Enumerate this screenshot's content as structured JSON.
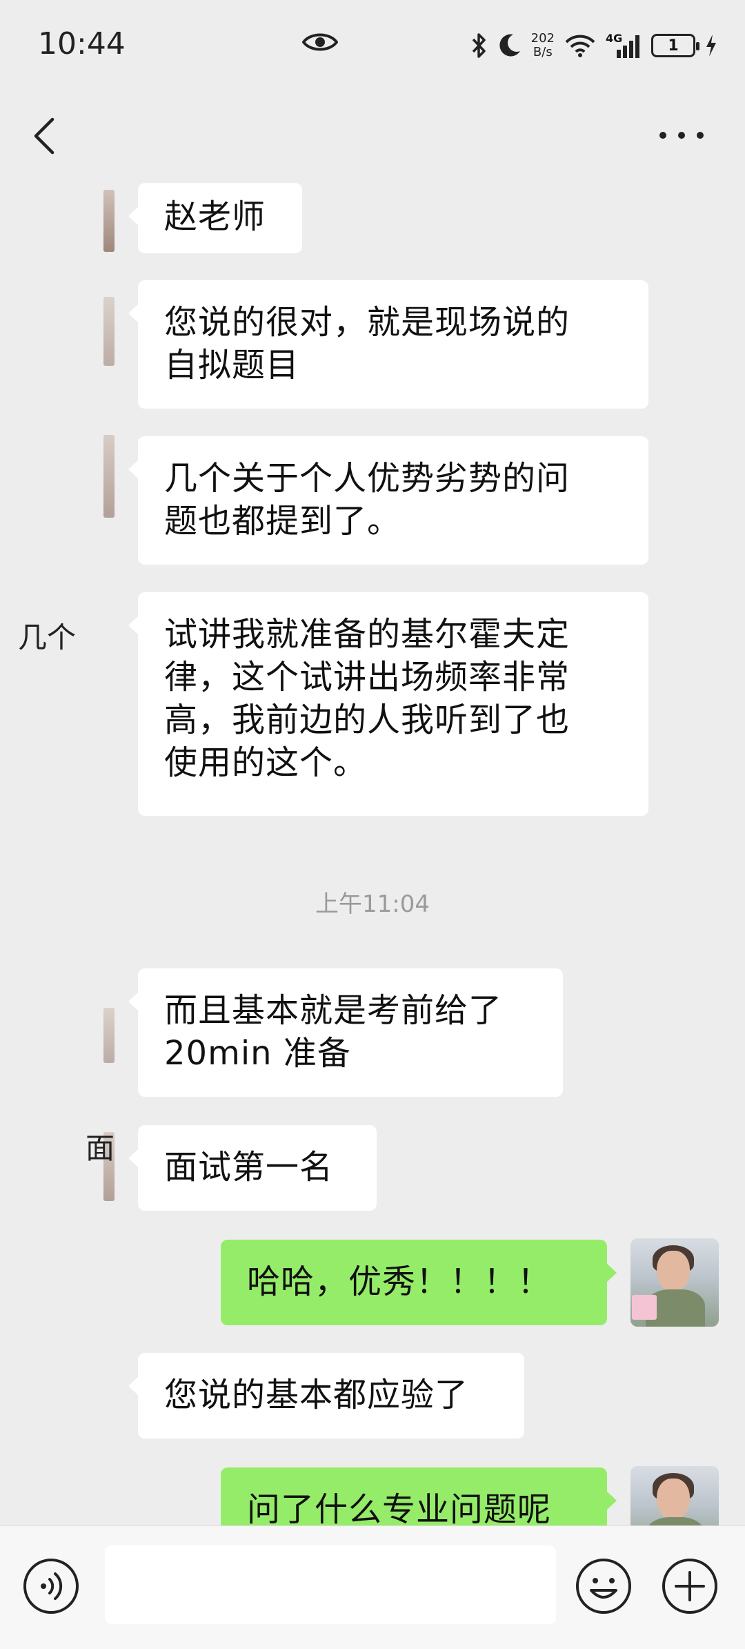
{
  "status_bar": {
    "time": "10:44",
    "net_speed_value": "202",
    "net_speed_unit": "B/s",
    "network": "4G",
    "battery": "1"
  },
  "messages": [
    {
      "side": "left",
      "text": "赵老师"
    },
    {
      "side": "left",
      "text": "您说的很对，就是现场说的\n自拟题目"
    },
    {
      "side": "left",
      "text": "几个关于个人优势劣势的问\n题也都提到了。"
    },
    {
      "side": "left",
      "text": "试讲我就准备的基尔霍夫定\n律，这个试讲出场频率非常\n高，我前边的人我听到了也\n使用的这个。"
    },
    {
      "side": "left",
      "text": "而且基本就是考前给了\n20min 准备"
    },
    {
      "side": "left",
      "text": "面试第一名"
    },
    {
      "side": "right",
      "text": "哈哈，优秀！！！！"
    },
    {
      "side": "left",
      "text": "您说的基本都应验了"
    },
    {
      "side": "right",
      "text": "问了什么专业问题呢"
    }
  ],
  "timestamp": "上午11:04",
  "fragments": {
    "frag1": "几个",
    "frag2": "面"
  },
  "input": {
    "value": ""
  },
  "colors": {
    "background": "#ededed",
    "left_bubble": "#ffffff",
    "right_bubble": "#95ec69"
  },
  "icons": [
    "eye-icon",
    "bluetooth-icon",
    "moon-icon",
    "wifi-icon",
    "signal-icon",
    "battery-icon",
    "charging-icon",
    "back-icon",
    "more-icon",
    "voice-icon",
    "emoji-icon",
    "plus-icon"
  ]
}
